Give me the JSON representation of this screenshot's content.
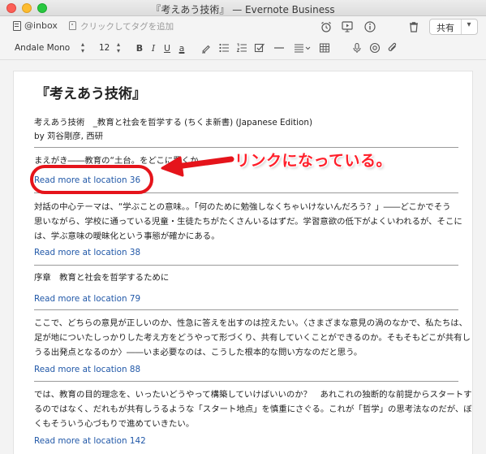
{
  "window": {
    "title": "『考えあう技術』 — Evernote Business"
  },
  "toolbar": {
    "notebook_label": "@inbox",
    "tag_placeholder": "クリックしてタグを追加",
    "share_label": "共有",
    "share_caret": "▾",
    "icons": [
      "reminder-icon",
      "presentation-icon",
      "info-icon",
      "trash-icon"
    ]
  },
  "format_bar": {
    "font_name": "Andale Mono",
    "font_size": "12",
    "bold": "B",
    "italic": "I",
    "underline": "U",
    "highlight": "a"
  },
  "note": {
    "title": "『考えあう技術』",
    "book_line": "考えあう技術　_教育と社会を哲学する (ちくま新書) (Japanese Edition)",
    "author_line": "by 苅谷剛彦, 西研",
    "entries": [
      {
        "lines": [
          "まえがき――教育の“土台。をどこに置くか"
        ],
        "link": "Read more at location 36"
      },
      {
        "lines": [
          "対話の中心テーマは、“学ぶことの意味。。「何のために勉強しなくちゃいけないんだろう？」――どこかでそう",
          "思いながら、学校に通っている児童・生徒たちがたくさんいるはずだ。学習意欲の低下がよくいわれるが、そこに",
          "は、学ぶ意味の曖昧化という事態が確かにある。"
        ],
        "link": "Read more at location 38"
      },
      {
        "lines": [
          "序章　教育と社会を哲学するために"
        ],
        "link": "Read more at location 79"
      },
      {
        "lines": [
          "ここで、どちらの意見が正しいのか、性急に答えを出すのは控えたい。〈さまざまな意見の渦のなかで、私たちは、",
          "足が地についたしっかりした考え方をどうやって形づくり、共有していくことができるのか。そもそもどこが共有し",
          "うる出発点となるのか〉――いま必要なのは、こうした根本的な問い方なのだと思う。"
        ],
        "link": "Read more at location 88"
      },
      {
        "lines": [
          "では、教育の目的理念を、いったいどうやって構築していけばいいのか？　あれこれの独断的な前提からスタートす",
          "るのではなく、だれもが共有しうるような「スタート地点」を慎重にさぐる。これが「哲学」の思考法なのだが、ぼ",
          "くもそういう心づもりで進めていきたい。"
        ],
        "link": "Read more at location 142"
      }
    ]
  },
  "annotation": {
    "callout": "リンクになっている。",
    "color": "#e5141b"
  }
}
